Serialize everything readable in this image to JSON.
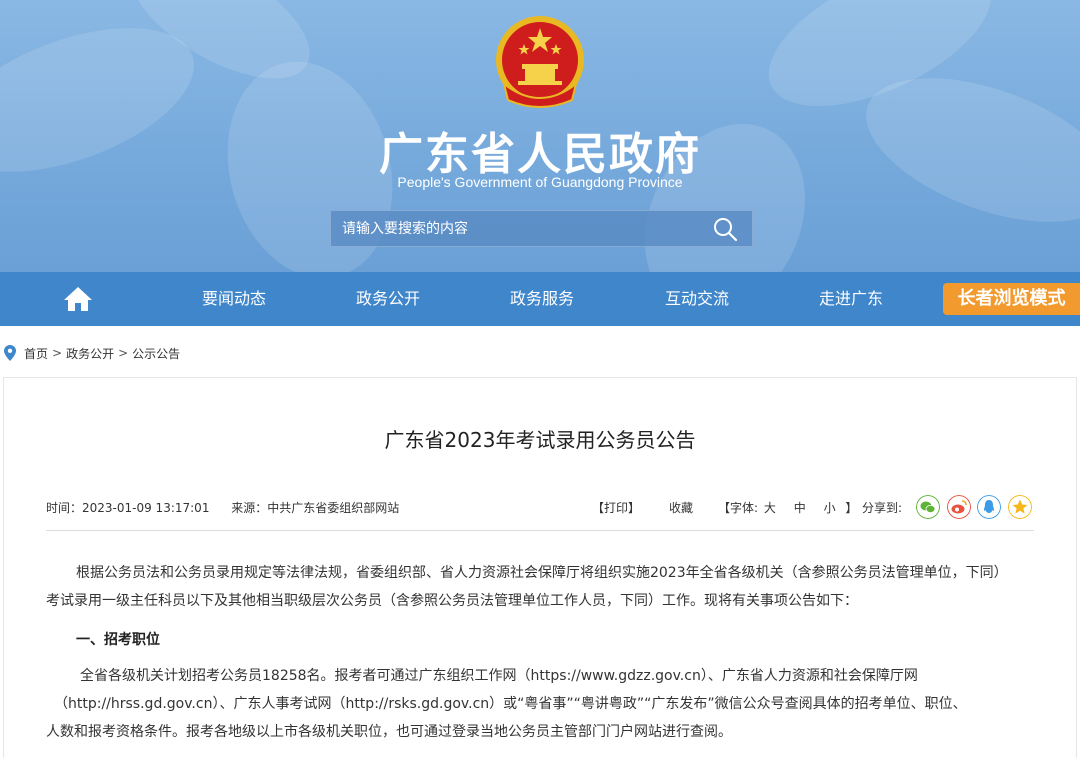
{
  "header": {
    "title": "广东省人民政府",
    "subtitle": "People's Government of Guangdong Province",
    "search_placeholder": "请输入要搜索的内容"
  },
  "nav": {
    "items": [
      "要闻动态",
      "政务公开",
      "政务服务",
      "互动交流",
      "走进广东"
    ],
    "elder_mode": "长者浏览模式"
  },
  "breadcrumb": [
    "首页",
    "政务公开",
    "公示公告"
  ],
  "article": {
    "title": "广东省2023年考试录用公务员公告",
    "time": "时间：2023-01-09 13:17:01",
    "source": "来源：中共广东省委组织部网站",
    "print": "【打印】",
    "favorite": "收藏",
    "font_label": "【字体:",
    "font_large": "大",
    "font_medium": "中",
    "font_small": "小",
    "font_close": "】",
    "share_label": "分享到:",
    "para1_line1": "根据公务员法和公务员录用规定等法律法规，省委组织部、省人力资源社会保障厅将组织实施2023年全省各级机关（含参照公务员法管理单位，下同）",
    "para1_line2": "考试录用一级主任科员以下及其他相当职级层次公务员（含参照公务员法管理单位工作人员，下同）工作。现将有关事项公告如下：",
    "heading1": "一、招考职位",
    "para2_line1": "全省各级机关计划招考公务员18258名。报考者可通过广东组织工作网（https://www.gdzz.gov.cn）、广东省人力资源和社会保障厅网",
    "para2_line2": "（http://hrss.gd.gov.cn）、广东人事考试网（http://rsks.gd.gov.cn）或“粤省事”“粤讲粤政”“广东发布”微信公众号查阅具体的招考单位、职位、",
    "para2_line3": "人数和报考资格条件。报考各地级以上市各级机关职位，也可通过登录当地公务员主管部门门户网站进行查阅。"
  },
  "colors": {
    "banner": "#77aadc",
    "nav": "#3f86ca",
    "elder_button": "#f29a2e",
    "wechat": "#5fb336",
    "weibo": "#e8523f",
    "qq": "#3e9ce6",
    "qzone": "#f5b81c"
  },
  "icons": [
    "national-emblem-icon",
    "search-icon",
    "home-icon",
    "location-pin-icon",
    "wechat-icon",
    "weibo-icon",
    "qq-icon",
    "qzone-icon"
  ]
}
